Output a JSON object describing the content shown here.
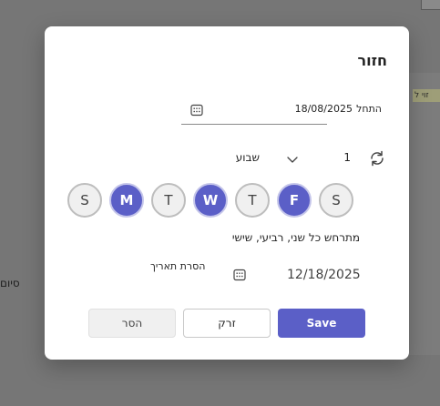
{
  "background": {
    "side_text": "סיום",
    "panel_strip_text": "זוי ל"
  },
  "dialog": {
    "title": "חזור",
    "start": {
      "label": "התחל",
      "value": "18/08/2025"
    },
    "frequency": {
      "interval": "1",
      "unit": "שבוע"
    },
    "days": [
      {
        "label": "S",
        "selected": false
      },
      {
        "label": "M",
        "selected": true
      },
      {
        "label": "T",
        "selected": false
      },
      {
        "label": "W",
        "selected": true
      },
      {
        "label": "T",
        "selected": false
      },
      {
        "label": "F",
        "selected": true
      },
      {
        "label": "S",
        "selected": false
      }
    ],
    "summary": "מתרחש כל שני, רביעי, שישי",
    "end": {
      "date": "12/18/2025",
      "remove_label": "הסרת תאריך"
    },
    "buttons": {
      "save": "Save",
      "discard": "זרק",
      "remove": "הסר"
    },
    "accent_color": "#5b5fc7"
  }
}
